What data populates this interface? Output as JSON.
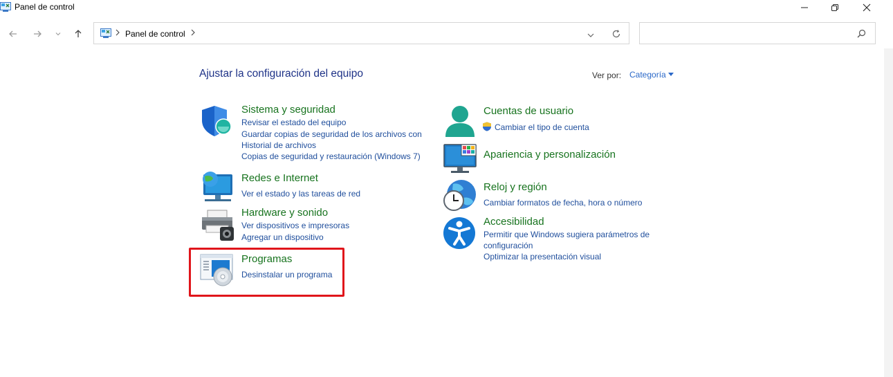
{
  "window": {
    "title": "Panel de control"
  },
  "address": {
    "path": "Panel de control"
  },
  "search": {
    "placeholder": ""
  },
  "heading": "Ajustar la configuración del equipo",
  "view_by": {
    "label": "Ver por:",
    "value": "Categoría"
  },
  "categories_left": [
    {
      "title": "Sistema y seguridad",
      "links": [
        "Revisar el estado del equipo",
        "Guardar copias de seguridad de los archivos con",
        "Historial de archivos",
        "Copias de seguridad y restauración (Windows 7)"
      ]
    },
    {
      "title": "Redes e Internet",
      "links": [
        "Ver el estado y las tareas de red"
      ]
    },
    {
      "title": "Hardware y sonido",
      "links": [
        "Ver dispositivos e impresoras",
        "Agregar un dispositivo"
      ]
    },
    {
      "title": "Programas",
      "links": [
        "Desinstalar un programa"
      ]
    }
  ],
  "categories_right": [
    {
      "title": "Cuentas de usuario",
      "links": [
        "Cambiar el tipo de cuenta"
      ]
    },
    {
      "title": "Apariencia y personalización",
      "links": []
    },
    {
      "title": "Reloj y región",
      "links": [
        "Cambiar formatos de fecha, hora o número"
      ]
    },
    {
      "title": "Accesibilidad",
      "links": [
        "Permitir que Windows sugiera parámetros de",
        "configuración",
        "Optimizar la presentación visual"
      ]
    }
  ],
  "colors": {
    "heading": "#1e3287",
    "category_title": "#17731e",
    "link": "#1f4e9c",
    "accent": "#2a68c8",
    "highlight": "#e0151b"
  }
}
